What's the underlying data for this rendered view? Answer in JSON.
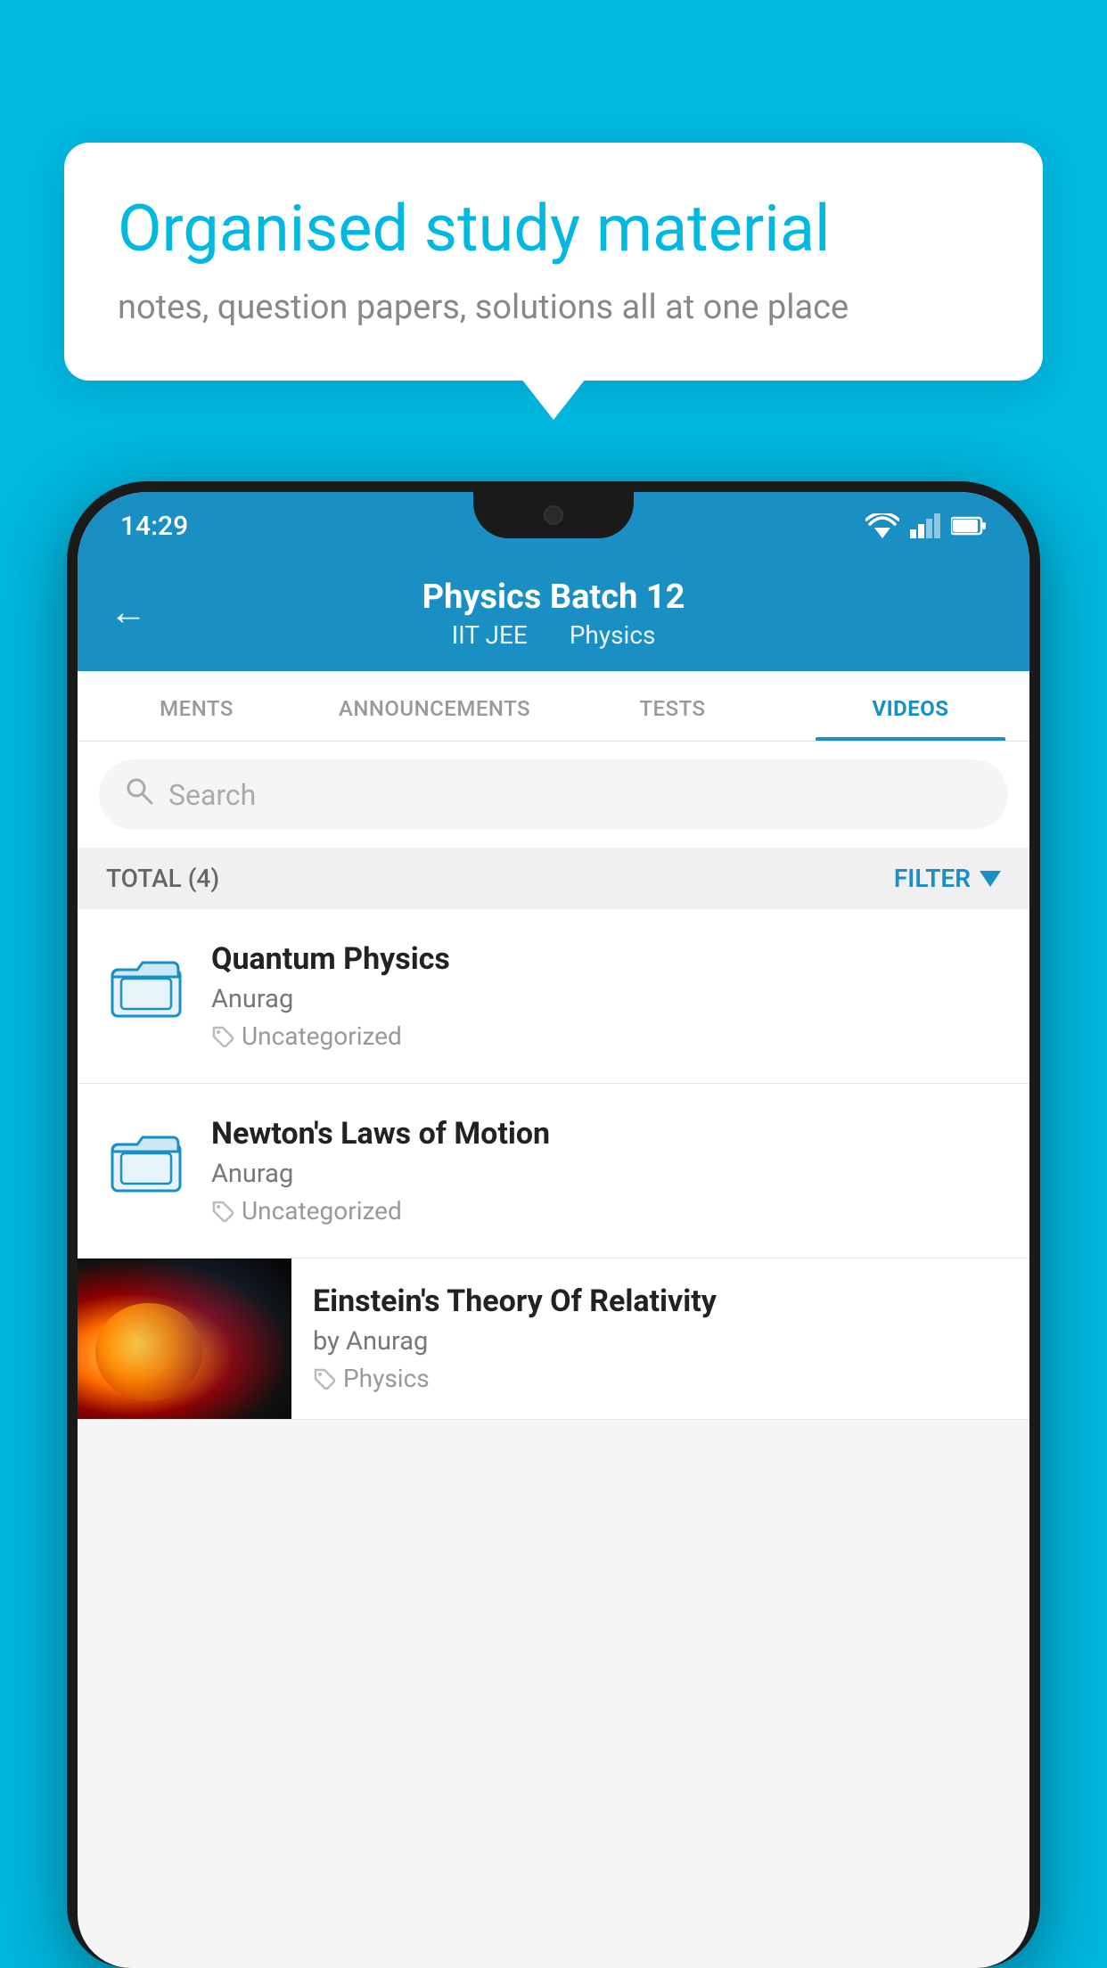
{
  "background_color": "#00b8e0",
  "bubble": {
    "title": "Organised study material",
    "subtitle": "notes, question papers, solutions all at one place"
  },
  "status_bar": {
    "time": "14:29",
    "wifi": "▼▲",
    "signal": "▲",
    "battery": "▪"
  },
  "header": {
    "back_label": "←",
    "title": "Physics Batch 12",
    "subtitle_part1": "IIT JEE",
    "subtitle_part2": "Physics"
  },
  "tabs": [
    {
      "label": "MENTS",
      "active": false
    },
    {
      "label": "ANNOUNCEMENTS",
      "active": false
    },
    {
      "label": "TESTS",
      "active": false
    },
    {
      "label": "VIDEOS",
      "active": true
    }
  ],
  "search": {
    "placeholder": "Search"
  },
  "filter_bar": {
    "total_label": "TOTAL (4)",
    "filter_label": "FILTER"
  },
  "videos": [
    {
      "id": 1,
      "title": "Quantum Physics",
      "author": "Anurag",
      "tag": "Uncategorized",
      "has_thumbnail": false
    },
    {
      "id": 2,
      "title": "Newton's Laws of Motion",
      "author": "Anurag",
      "tag": "Uncategorized",
      "has_thumbnail": false
    },
    {
      "id": 3,
      "title": "Einstein's Theory Of Relativity",
      "author": "by Anurag",
      "tag": "Physics",
      "has_thumbnail": true
    }
  ]
}
